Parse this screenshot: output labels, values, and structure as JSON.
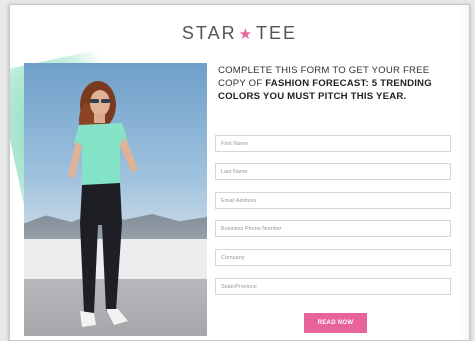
{
  "brand": {
    "logo_left": "STAR",
    "logo_star": "★",
    "logo_right": "TEE",
    "accent_color": "#e7649a",
    "mint_color": "#75d6b3"
  },
  "offer": {
    "line1": "COMPLETE THIS FORM TO GET YOUR FREE",
    "line2_prefix": "COPY OF ",
    "line2_bold": "FASHION FORECAST: 5 TRENDING",
    "line3_bold": "COLORS YOU MUST PITCH THIS YEAR."
  },
  "form": {
    "fields": [
      {
        "placeholder": "First Name"
      },
      {
        "placeholder": "Last Name"
      },
      {
        "placeholder": "Email Address"
      },
      {
        "placeholder": "Business Phone Number"
      },
      {
        "placeholder": "Company"
      },
      {
        "placeholder": "State/Province"
      }
    ],
    "submit_label": "READ NOW"
  }
}
